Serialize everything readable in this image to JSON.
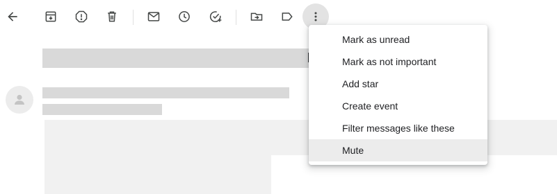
{
  "toolbar": {
    "icons": [
      "back-arrow-icon",
      "archive-icon",
      "report-spam-icon",
      "delete-icon",
      "mark-unread-icon",
      "snooze-icon",
      "add-to-tasks-icon",
      "move-to-icon",
      "label-icon",
      "more-vert-icon"
    ],
    "active": "more-vert-icon"
  },
  "menu": {
    "items": [
      {
        "label": "Mark as unread"
      },
      {
        "label": "Mark as not important"
      },
      {
        "label": "Add star"
      },
      {
        "label": "Create event"
      },
      {
        "label": "Filter messages like these"
      },
      {
        "label": "Mute"
      }
    ],
    "highlighted_item": "Mute"
  },
  "colors": {
    "icon": "#444746",
    "placeholder": "#d9d9d9",
    "placeholder_light": "#f1f1f1",
    "highlight": "#ececec",
    "text": "#202124"
  }
}
